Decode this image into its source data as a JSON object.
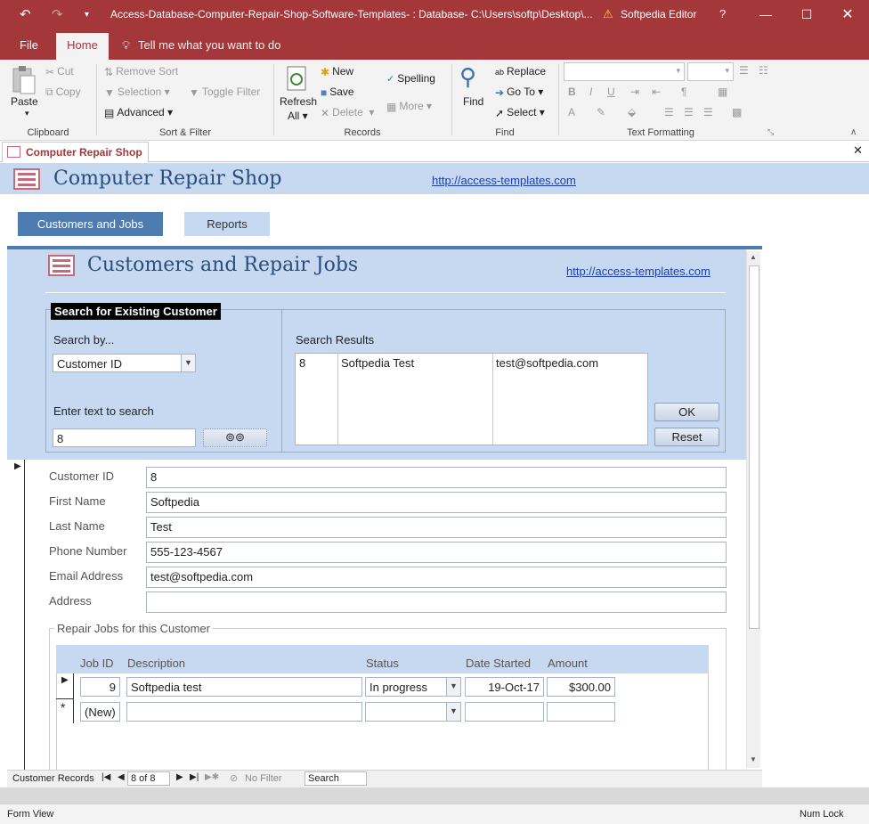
{
  "window": {
    "title": "Access-Database-Computer-Repair-Shop-Software-Templates- : Database- C:\\Users\\softp\\Desktop\\...",
    "account": "Softpedia Editor",
    "help": "?"
  },
  "menu": {
    "file": "File",
    "home": "Home",
    "tell_me": "Tell me what you want to do"
  },
  "ribbon": {
    "clipboard": {
      "paste": "Paste",
      "cut": "Cut",
      "copy": "Copy",
      "group": "Clipboard"
    },
    "sort_filter": {
      "remove_sort": "Remove Sort",
      "selection": "Selection",
      "advanced": "Advanced",
      "toggle_filter": "Toggle Filter",
      "group": "Sort & Filter"
    },
    "records": {
      "refresh": "Refresh",
      "refresh_all": "All",
      "new": "New",
      "save": "Save",
      "delete": "Delete",
      "spelling": "Spelling",
      "more": "More",
      "group": "Records"
    },
    "find": {
      "find": "Find",
      "replace": "Replace",
      "go_to": "Go To",
      "select": "Select",
      "group": "Find"
    },
    "text_formatting": {
      "bold": "B",
      "italic": "I",
      "underline": "U",
      "font_color": "A",
      "group": "Text Formatting"
    }
  },
  "doc_tab": {
    "label": "Computer Repair Shop"
  },
  "header": {
    "title": "Computer Repair Shop",
    "link": "http://access-templates.com"
  },
  "nav": {
    "customers_jobs": "Customers and Jobs",
    "reports": "Reports"
  },
  "form": {
    "title": "Customers and Repair Jobs",
    "link": "http://access-templates.com",
    "search": {
      "legend": "Search for Existing Customer",
      "search_by_label": "Search by...",
      "search_by_value": "Customer ID",
      "enter_text_label": "Enter text to search",
      "search_value": "8",
      "results_label": "Search Results",
      "results": [
        {
          "id": "8",
          "name": "Softpedia Test",
          "email": "test@softpedia.com"
        }
      ],
      "ok": "OK",
      "reset": "Reset"
    },
    "customer": {
      "id_label": "Customer ID",
      "id_value": "8",
      "first_label": "First Name",
      "first_value": "Softpedia",
      "last_label": "Last Name",
      "last_value": "Test",
      "phone_label": "Phone Number",
      "phone_value": "555-123-4567",
      "email_label": "Email Address",
      "email_value": "test@softpedia.com",
      "address_label": "Address",
      "address_value": ""
    },
    "jobs": {
      "legend": "Repair Jobs for this Customer",
      "headers": {
        "job_id": "Job ID",
        "description": "Description",
        "status": "Status",
        "date_started": "Date Started",
        "amount": "Amount"
      },
      "rows": [
        {
          "job_id": "9",
          "description": "Softpedia test",
          "status": "In progress",
          "date_started": "19-Oct-17",
          "amount": "$300.00"
        }
      ],
      "new_row": "(New)"
    }
  },
  "record_nav": {
    "label": "Customer Records",
    "position": "8 of 8",
    "filter": "No Filter",
    "search": "Search"
  },
  "status": {
    "left": "Form View",
    "right": "Num Lock"
  },
  "colors": {
    "brand": "#a4373a",
    "form_bg": "#c6d9f1",
    "accent_bar": "#4e7cb1"
  }
}
